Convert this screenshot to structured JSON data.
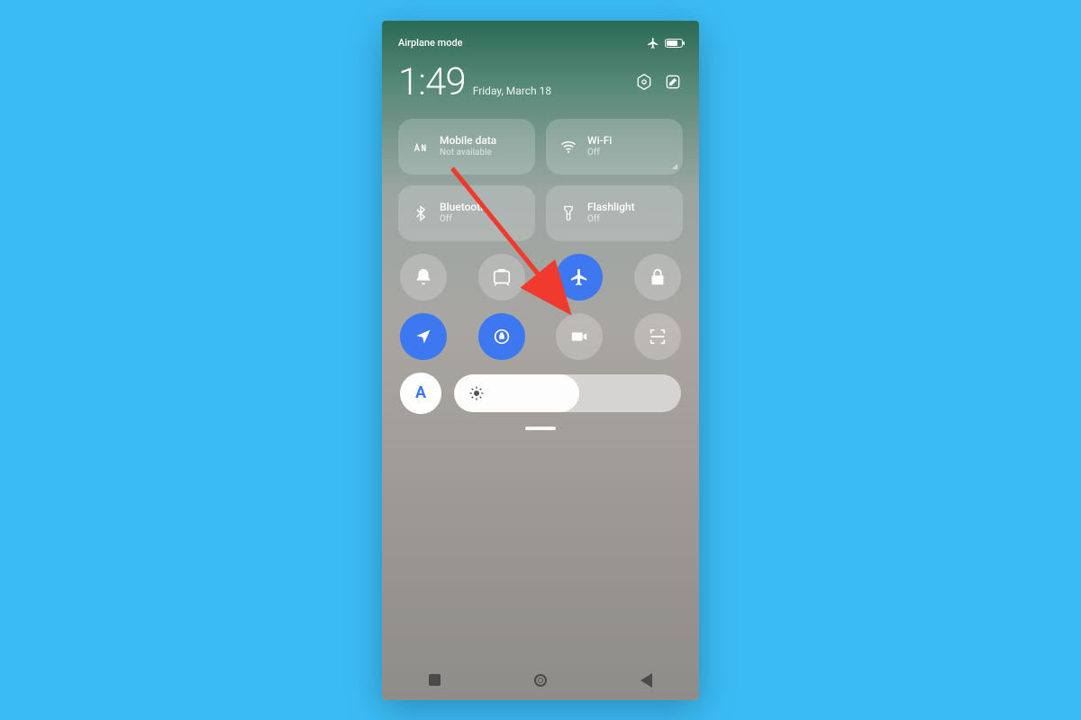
{
  "status": {
    "mode_label": "Airplane mode",
    "battery_percent": 70
  },
  "clock": {
    "time": "1:49",
    "date": "Friday, March 18",
    "settings_icon": "settings-hex-icon",
    "edit_icon": "edit-icon"
  },
  "big_tiles": {
    "mobile_data": {
      "label": "Mobile data",
      "sub": "Not available"
    },
    "wifi": {
      "label": "Wi-Fi",
      "sub": "Off"
    },
    "bluetooth": {
      "label": "Bluetooth",
      "sub": "Off"
    },
    "flashlight": {
      "label": "Flashlight",
      "sub": "Off"
    }
  },
  "circle_toggles": [
    {
      "name": "notifications-toggle",
      "icon": "bell-icon",
      "active": false
    },
    {
      "name": "screenshot-toggle",
      "icon": "screenshot-icon",
      "active": false
    },
    {
      "name": "airplane-toggle",
      "icon": "airplane-icon",
      "active": true
    },
    {
      "name": "lock-toggle",
      "icon": "lock-icon",
      "active": false
    },
    {
      "name": "location-toggle",
      "icon": "location-arrow-icon",
      "active": true
    },
    {
      "name": "rotation-lock-toggle",
      "icon": "rotation-lock-icon",
      "active": true
    },
    {
      "name": "screen-record-toggle",
      "icon": "video-camera-icon",
      "active": false
    },
    {
      "name": "scanner-toggle",
      "icon": "scan-icon",
      "active": false
    }
  ],
  "brightness": {
    "auto_label": "A",
    "level_percent": 55
  },
  "colors": {
    "accent": "#3E78F0",
    "tile_translucent": "rgba(255,255,255,0.18)",
    "background_outer": "#3BBBF5"
  },
  "annotation": {
    "arrow_target": "airplane-toggle",
    "arrow_color": "#F03A2E"
  }
}
